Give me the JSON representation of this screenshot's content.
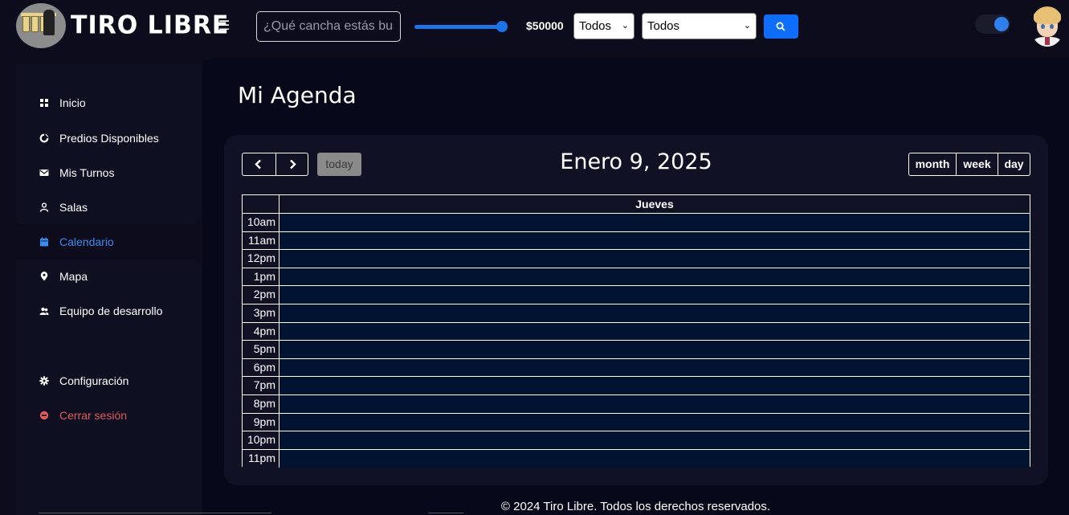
{
  "brand": {
    "name": "TIRO LIBRE"
  },
  "header": {
    "search_placeholder": "¿Qué cancha estás buscando?",
    "price_label": "$50000",
    "price_fraction": 0.93,
    "filter_one": "Todos",
    "filter_two": "Todos",
    "theme_toggle_on": true
  },
  "sidebar": {
    "items": [
      {
        "label": "Inicio",
        "icon": "grid-icon"
      },
      {
        "label": "Predios Disponibles",
        "icon": "pie-icon"
      },
      {
        "label": "Mis Turnos",
        "icon": "envelope-icon"
      },
      {
        "label": "Salas",
        "icon": "user-icon"
      },
      {
        "label": "Calendario",
        "icon": "calendar-icon",
        "active": true
      },
      {
        "label": "Mapa",
        "icon": "map-pin-icon"
      },
      {
        "label": "Equipo de desarrollo",
        "icon": "team-icon"
      },
      {
        "label": "Configuración",
        "icon": "gear-icon"
      },
      {
        "label": "Cerrar sesión",
        "icon": "logout-icon",
        "danger": true
      }
    ]
  },
  "main": {
    "title": "Mi Agenda",
    "calendar": {
      "today_label": "today",
      "date_title": "Enero 9, 2025",
      "views": {
        "month": "month",
        "week": "week",
        "day": "day"
      },
      "day_name": "Jueves",
      "time_slots": [
        "10am",
        "11am",
        "12pm",
        "1pm",
        "2pm",
        "3pm",
        "4pm",
        "5pm",
        "6pm",
        "7pm",
        "8pm",
        "9pm",
        "10pm",
        "11pm"
      ]
    }
  },
  "footer": {
    "text": "© 2024 Tiro Libre. Todos los derechos reservados."
  },
  "colors": {
    "accent": "#0d6efd",
    "active_link": "#3b8bf0",
    "danger": "#e25b5b",
    "slot_fill": "#021331",
    "background": "#0c0c1c"
  }
}
